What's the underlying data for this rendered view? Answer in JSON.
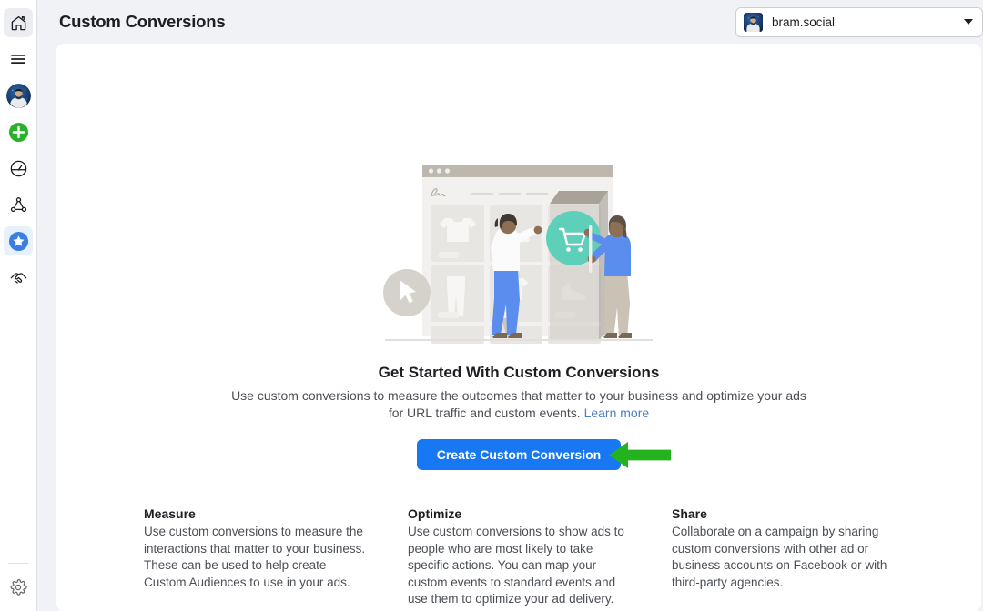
{
  "header": {
    "title": "Custom Conversions",
    "account": {
      "name": "bram.social",
      "avatar_icon": "user-photo-avatar",
      "caret_icon": "chevron-down-icon"
    }
  },
  "sidebar": {
    "items": [
      {
        "name": "home",
        "icon": "home-icon",
        "active": false
      },
      {
        "name": "menu",
        "icon": "hamburger-menu-icon",
        "active": false
      },
      {
        "name": "profile",
        "icon": "avatar-photo",
        "active": false
      },
      {
        "name": "create",
        "icon": "plus-circle-icon",
        "active": false
      },
      {
        "name": "performance",
        "icon": "gauge-icon",
        "active": false
      },
      {
        "name": "audiences",
        "icon": "network-nodes-icon",
        "active": false
      },
      {
        "name": "custom-conversions",
        "icon": "star-circle-icon",
        "active": true
      },
      {
        "name": "partnerships",
        "icon": "handshake-icon",
        "active": false
      }
    ],
    "bottom_items": [
      {
        "name": "settings",
        "icon": "gear-icon"
      }
    ]
  },
  "empty_state": {
    "illustration_name": "storefront-shopping-illustration",
    "title": "Get Started With Custom Conversions",
    "description": "Use custom conversions to measure the outcomes that matter to your business and optimize your ads for URL traffic and custom events.",
    "learn_more": "Learn more",
    "cta_label": "Create Custom Conversion",
    "annotation_icon": "green-left-arrow-annotation"
  },
  "features": [
    {
      "title": "Measure",
      "body": "Use custom conversions to measure the interactions that matter to your business. These can be used to help create Custom Audiences to use in your ads."
    },
    {
      "title": "Optimize",
      "body": "Use custom conversions to show ads to people who are most likely to take specific actions. You can map your custom events to standard events and use them to optimize your ad delivery."
    },
    {
      "title": "Share",
      "body": "Collaborate on a campaign by sharing custom conversions with other ad or business accounts on Facebook or with third-party agencies."
    }
  ],
  "colors": {
    "brand_blue": "#1877f2",
    "link_blue": "#4a7fc1",
    "annotation_green": "#22b31e",
    "accent_teal": "#5ecfb8",
    "page_bg": "#f0f2f5",
    "card_bg": "#ffffff",
    "text_primary": "#1c1e21",
    "text_secondary": "#4b4f56",
    "create_green": "#2ab12a"
  }
}
